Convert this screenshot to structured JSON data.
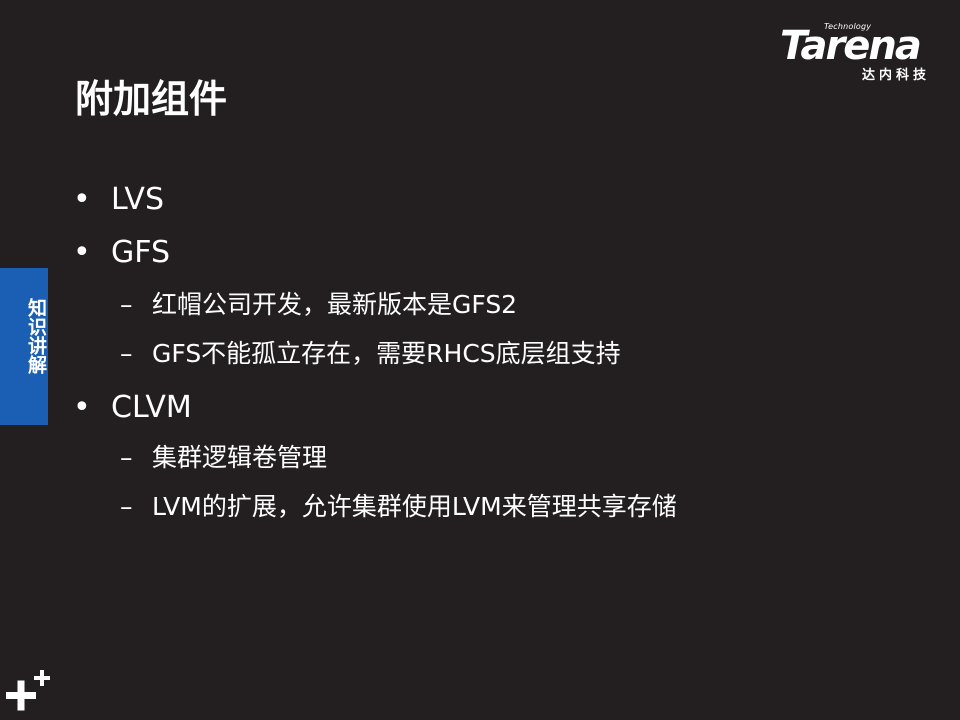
{
  "logo": {
    "tagline": "Technology",
    "wordmark": "Tarena",
    "chinese": "达内科技"
  },
  "slide": {
    "title": "附加组件",
    "side_tab": "知识讲解",
    "items": [
      {
        "level": 1,
        "marker": "•",
        "text": "LVS"
      },
      {
        "level": 1,
        "marker": "•",
        "text": "GFS"
      },
      {
        "level": 2,
        "marker": "–",
        "text": "红帽公司开发，最新版本是GFS2"
      },
      {
        "level": 2,
        "marker": "–",
        "text": "GFS不能孤立存在，需要RHCS底层组支持"
      },
      {
        "level": 1,
        "marker": "•",
        "text": "CLVM"
      },
      {
        "level": 2,
        "marker": "–",
        "text": "集群逻辑卷管理"
      },
      {
        "level": 2,
        "marker": "–",
        "text": "LVM的扩展，允许集群使用LVM来管理共享存储"
      }
    ]
  },
  "icons": {
    "corner": "plus-icon"
  },
  "colors": {
    "background": "#231f20",
    "side_tab": "#1a5fb4",
    "text": "#ffffff"
  }
}
